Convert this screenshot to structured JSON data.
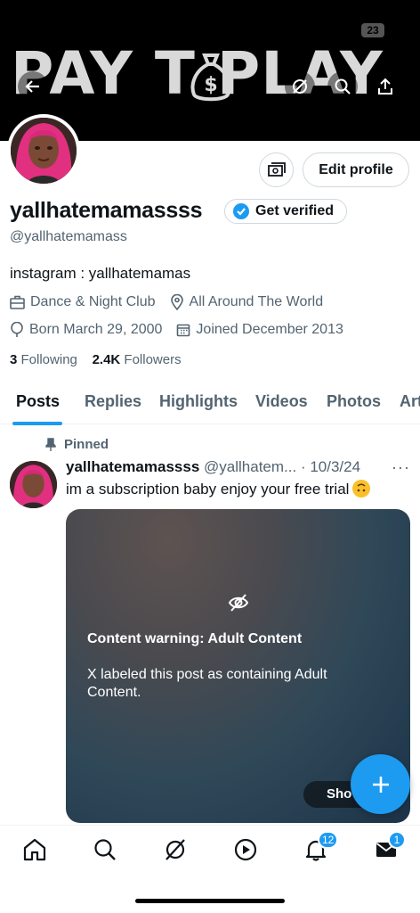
{
  "banner": {
    "text": "PAY T  PLAY",
    "battery": "23"
  },
  "profile": {
    "display_name": "yallhatemamassss",
    "handle": "@yallhatemamass",
    "verify_label": "Get verified",
    "edit_label": "Edit profile",
    "bio": "instagram : yallhatemamas",
    "category": "Dance & Night Club",
    "location": "All Around The World",
    "born": "Born March 29, 2000",
    "joined": "Joined December 2013",
    "following_count": "3",
    "following_label": "Following",
    "followers_count": "2.4K",
    "followers_label": "Followers"
  },
  "tabs": [
    {
      "label": "Posts"
    },
    {
      "label": "Replies"
    },
    {
      "label": "Highlights"
    },
    {
      "label": "Videos"
    },
    {
      "label": "Photos"
    },
    {
      "label": "Art"
    }
  ],
  "post": {
    "pinned_label": "Pinned",
    "author_name": "yallhatemamassss",
    "author_handle": "@yallhatem...",
    "date": "· 10/3/24",
    "text": "im a subscription baby enjoy your free trial",
    "more": "···",
    "warning_title": "Content warning: Adult Content",
    "warning_body": "X labeled this post as containing Adult Content.",
    "show_label": "Sho"
  },
  "nav": {
    "notifications_badge": "12",
    "messages_badge": "1"
  },
  "colors": {
    "accent": "#1d9bf0",
    "text": "#0f1419",
    "muted": "#536471"
  }
}
